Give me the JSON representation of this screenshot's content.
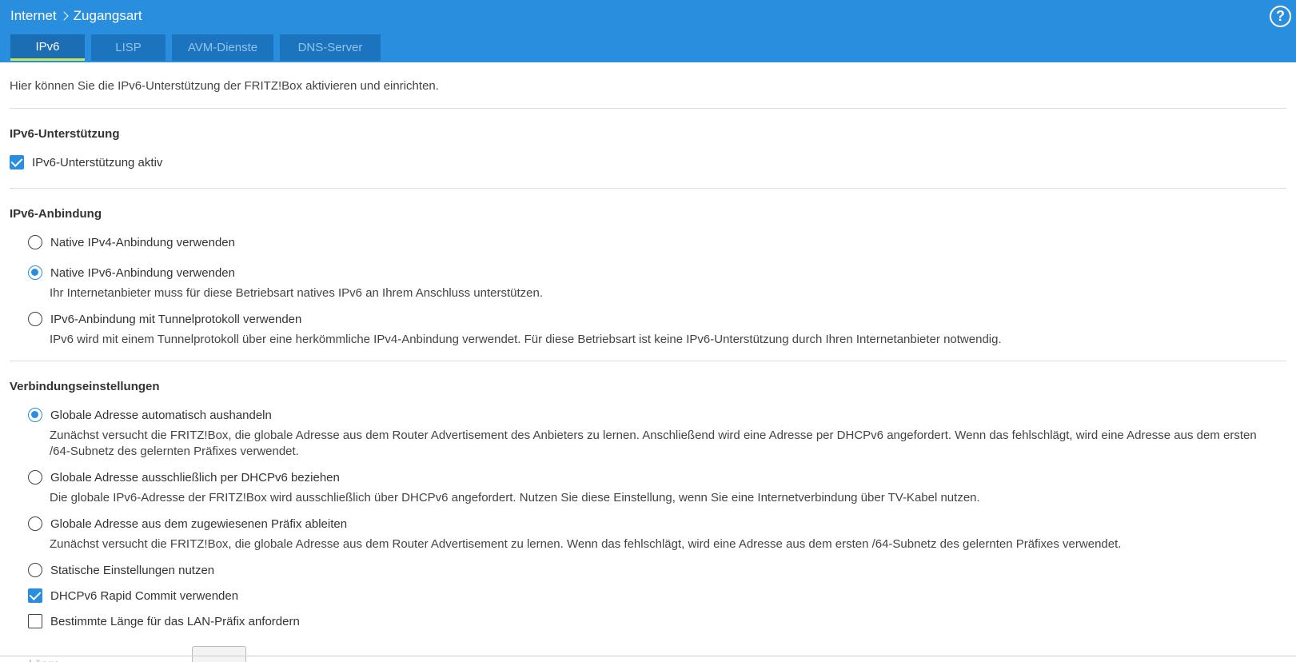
{
  "header": {
    "breadcrumb": [
      "Internet",
      "Zugangsart"
    ],
    "help_label": "?"
  },
  "tabs": [
    {
      "label": "IPv6",
      "active": true
    },
    {
      "label": "LISP",
      "active": false
    },
    {
      "label": "AVM-Dienste",
      "active": false
    },
    {
      "label": "DNS-Server",
      "active": false
    }
  ],
  "intro": "Hier können Sie die IPv6-Unterstützung der FRITZ!Box aktivieren und einrichten.",
  "support": {
    "title": "IPv6-Unterstützung",
    "checkbox_label": "IPv6-Unterstützung aktiv",
    "checked": true
  },
  "connection": {
    "title": "IPv6-Anbindung",
    "options": [
      {
        "label": "Native IPv4-Anbindung verwenden",
        "checked": false,
        "desc": ""
      },
      {
        "label": "Native IPv6-Anbindung verwenden",
        "checked": true,
        "desc": "Ihr Internetanbieter muss für diese Betriebsart natives IPv6 an Ihrem Anschluss unterstützen."
      },
      {
        "label": "IPv6-Anbindung mit Tunnelprotokoll verwenden",
        "checked": false,
        "desc": "IPv6 wird mit einem Tunnelprotokoll über eine herkömmliche IPv4-Anbindung verwendet. Für diese Betriebsart ist keine IPv6-Unterstützung durch Ihren Internetanbieter notwendig."
      }
    ]
  },
  "settings": {
    "title": "Verbindungseinstellungen",
    "options": [
      {
        "label": "Globale Adresse automatisch aushandeln",
        "checked": true,
        "desc": "Zunächst versucht die FRITZ!Box, die globale Adresse aus dem Router Advertisement des Anbieters zu lernen. Anschließend wird eine Adresse per DHCPv6 angefordert. Wenn das fehlschlägt, wird eine Adresse aus dem ersten /64-Subnetz des gelernten Präfixes verwendet."
      },
      {
        "label": "Globale Adresse ausschließlich per DHCPv6 beziehen",
        "checked": false,
        "desc": "Die globale IPv6-Adresse der FRITZ!Box wird ausschließlich über DHCPv6 angefordert. Nutzen Sie diese Einstellung, wenn Sie eine Internetverbindung über TV-Kabel nutzen."
      },
      {
        "label": "Globale Adresse aus dem zugewiesenen Präfix ableiten",
        "checked": false,
        "desc": "Zunächst versucht die FRITZ!Box, die globale Adresse aus dem Router Advertisement zu lernen. Wenn das fehlschlägt, wird eine Adresse aus dem ersten /64-Subnetz des gelernten Präfixes verwendet."
      },
      {
        "label": "Statische Einstellungen nutzen",
        "checked": false,
        "desc": ""
      }
    ],
    "checkboxes": [
      {
        "label": "DHCPv6 Rapid Commit verwenden",
        "checked": true
      },
      {
        "label": "Bestimmte Länge für das LAN-Präfix anfordern",
        "checked": false
      }
    ],
    "cut_off_label": "Länge"
  },
  "colors": {
    "header_bg": "#2a8ede",
    "tab_bg": "#1c74be",
    "tab_active_underline": "#c9e85a",
    "accent": "#2a8ede"
  }
}
